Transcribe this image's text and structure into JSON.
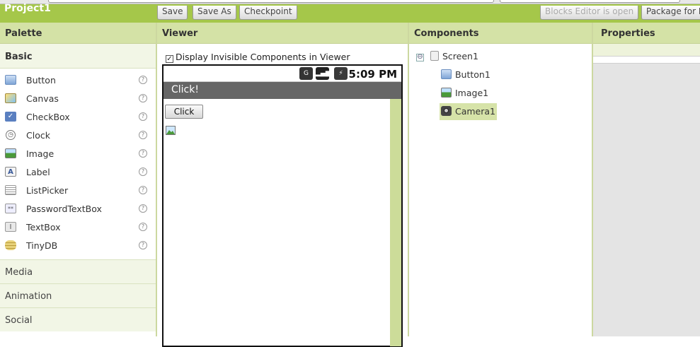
{
  "header": {
    "project_name": "Project1",
    "buttons": [
      "Save",
      "Save As",
      "Checkpoint"
    ],
    "blocks_editor_label": "Blocks Editor is open",
    "package_label": "Package for P",
    "accent_color": "#a5c74a"
  },
  "columns": {
    "palette": "Palette",
    "viewer": "Viewer",
    "components": "Components",
    "properties": "Properties"
  },
  "palette": {
    "basic_label": "Basic",
    "items": [
      {
        "label": "Button",
        "icon": "button-icon"
      },
      {
        "label": "Canvas",
        "icon": "canvas-icon"
      },
      {
        "label": "CheckBox",
        "icon": "checkbox-icon"
      },
      {
        "label": "Clock",
        "icon": "clock-icon"
      },
      {
        "label": "Image",
        "icon": "image-icon"
      },
      {
        "label": "Label",
        "icon": "label-icon"
      },
      {
        "label": "ListPicker",
        "icon": "listpicker-icon"
      },
      {
        "label": "PasswordTextBox",
        "icon": "password-icon"
      },
      {
        "label": "TextBox",
        "icon": "textbox-icon"
      },
      {
        "label": "TinyDB",
        "icon": "database-icon"
      }
    ],
    "help_glyph": "?",
    "groups": [
      "Media",
      "Animation",
      "Social"
    ]
  },
  "viewer": {
    "invisible_toggle_label": "Display Invisible Components in Viewer",
    "invisible_checked": true,
    "status_time": "5:09 PM",
    "screen_title": "Click!",
    "button_text": "Click"
  },
  "components": {
    "tree": [
      {
        "label": "Screen1",
        "icon": "screen-icon",
        "level": 0
      },
      {
        "label": "Button1",
        "icon": "button-icon",
        "level": 1
      },
      {
        "label": "Image1",
        "icon": "image-icon",
        "level": 1
      },
      {
        "label": "Camera1",
        "icon": "camera-icon",
        "level": 1,
        "selected": true
      }
    ],
    "collapse_glyph": "⊖"
  }
}
